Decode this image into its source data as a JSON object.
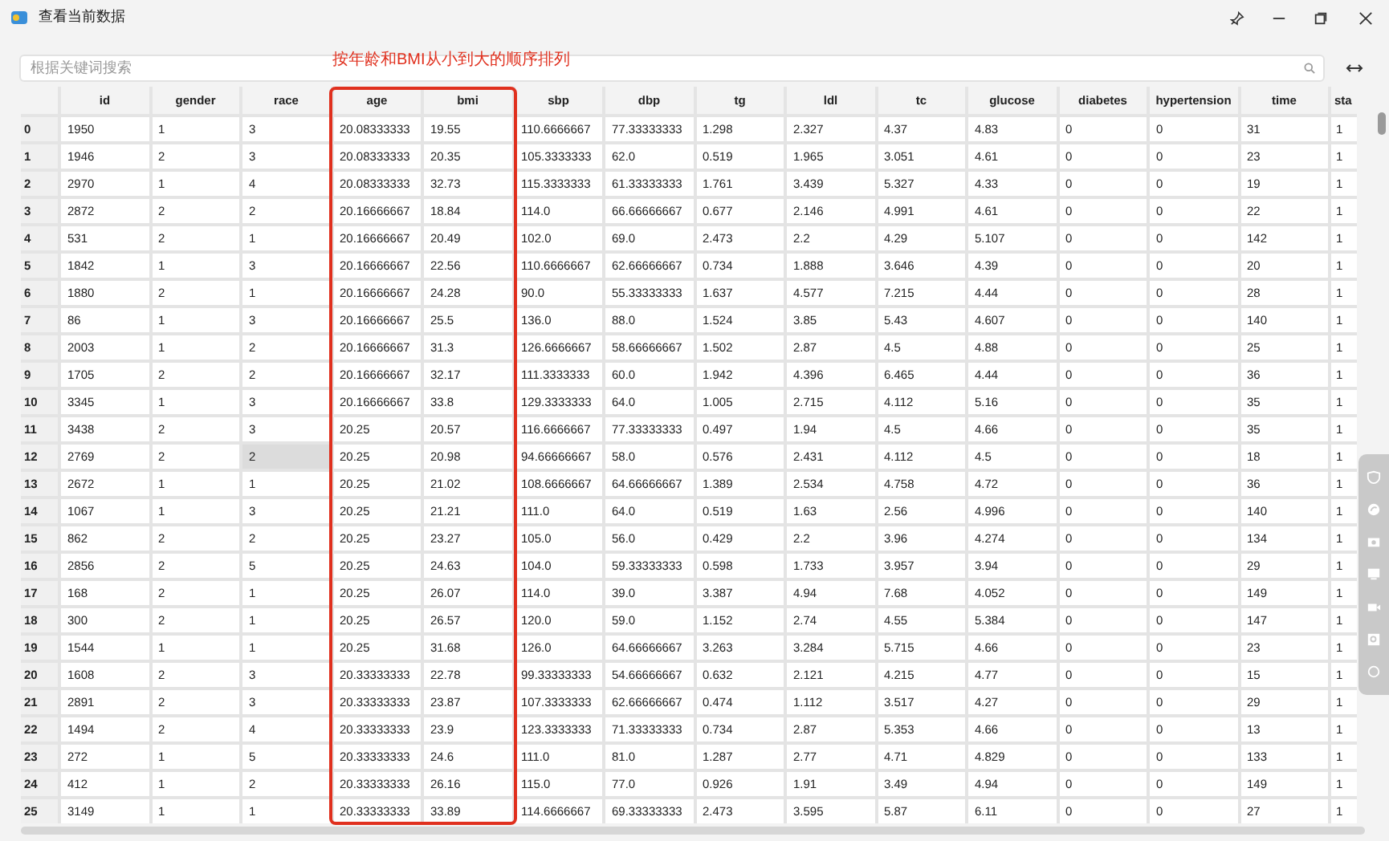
{
  "window": {
    "title": "查看当前数据"
  },
  "search": {
    "placeholder": "根据关键词搜索"
  },
  "annotation": {
    "text": "按年龄和BMI从小到大的顺序排列"
  },
  "table": {
    "columns": [
      "id",
      "gender",
      "race",
      "age",
      "bmi",
      "sbp",
      "dbp",
      "tg",
      "ldl",
      "tc",
      "glucose",
      "diabetes",
      "hypertension",
      "time",
      "sta"
    ],
    "rows": [
      {
        "label": "0",
        "cells": [
          "1950",
          "1",
          "3",
          "20.08333333",
          "19.55",
          "110.6666667",
          "77.33333333",
          "1.298",
          "2.327",
          "4.37",
          "4.83",
          "0",
          "0",
          "31",
          "1"
        ]
      },
      {
        "label": "1",
        "cells": [
          "1946",
          "2",
          "3",
          "20.08333333",
          "20.35",
          "105.3333333",
          "62.0",
          "0.519",
          "1.965",
          "3.051",
          "4.61",
          "0",
          "0",
          "23",
          "1"
        ]
      },
      {
        "label": "2",
        "cells": [
          "2970",
          "1",
          "4",
          "20.08333333",
          "32.73",
          "115.3333333",
          "61.33333333",
          "1.761",
          "3.439",
          "5.327",
          "4.33",
          "0",
          "0",
          "19",
          "1"
        ]
      },
      {
        "label": "3",
        "cells": [
          "2872",
          "2",
          "2",
          "20.16666667",
          "18.84",
          "114.0",
          "66.66666667",
          "0.677",
          "2.146",
          "4.991",
          "4.61",
          "0",
          "0",
          "22",
          "1"
        ]
      },
      {
        "label": "4",
        "cells": [
          "531",
          "2",
          "1",
          "20.16666667",
          "20.49",
          "102.0",
          "69.0",
          "2.473",
          "2.2",
          "4.29",
          "5.107",
          "0",
          "0",
          "142",
          "1"
        ]
      },
      {
        "label": "5",
        "cells": [
          "1842",
          "1",
          "3",
          "20.16666667",
          "22.56",
          "110.6666667",
          "62.66666667",
          "0.734",
          "1.888",
          "3.646",
          "4.39",
          "0",
          "0",
          "20",
          "1"
        ]
      },
      {
        "label": "6",
        "cells": [
          "1880",
          "2",
          "1",
          "20.16666667",
          "24.28",
          "90.0",
          "55.33333333",
          "1.637",
          "4.577",
          "7.215",
          "4.44",
          "0",
          "0",
          "28",
          "1"
        ]
      },
      {
        "label": "7",
        "cells": [
          "86",
          "1",
          "3",
          "20.16666667",
          "25.5",
          "136.0",
          "88.0",
          "1.524",
          "3.85",
          "5.43",
          "4.607",
          "0",
          "0",
          "140",
          "1"
        ]
      },
      {
        "label": "8",
        "cells": [
          "2003",
          "1",
          "2",
          "20.16666667",
          "31.3",
          "126.6666667",
          "58.66666667",
          "1.502",
          "2.87",
          "4.5",
          "4.88",
          "0",
          "0",
          "25",
          "1"
        ]
      },
      {
        "label": "9",
        "cells": [
          "1705",
          "2",
          "2",
          "20.16666667",
          "32.17",
          "111.3333333",
          "60.0",
          "1.942",
          "4.396",
          "6.465",
          "4.44",
          "0",
          "0",
          "36",
          "1"
        ]
      },
      {
        "label": "10",
        "cells": [
          "3345",
          "1",
          "3",
          "20.16666667",
          "33.8",
          "129.3333333",
          "64.0",
          "1.005",
          "2.715",
          "4.112",
          "5.16",
          "0",
          "0",
          "35",
          "1"
        ]
      },
      {
        "label": "11",
        "cells": [
          "3438",
          "2",
          "3",
          "20.25",
          "20.57",
          "116.6666667",
          "77.33333333",
          "0.497",
          "1.94",
          "4.5",
          "4.66",
          "0",
          "0",
          "35",
          "1"
        ]
      },
      {
        "label": "12",
        "cells": [
          "2769",
          "2",
          {
            "text": "2",
            "selected": true
          },
          "20.25",
          "20.98",
          "94.66666667",
          "58.0",
          "0.576",
          "2.431",
          "4.112",
          "4.5",
          "0",
          "0",
          "18",
          "1"
        ]
      },
      {
        "label": "13",
        "cells": [
          "2672",
          "1",
          "1",
          "20.25",
          "21.02",
          "108.6666667",
          "64.66666667",
          "1.389",
          "2.534",
          "4.758",
          "4.72",
          "0",
          "0",
          "36",
          "1"
        ]
      },
      {
        "label": "14",
        "cells": [
          "1067",
          "1",
          "3",
          "20.25",
          "21.21",
          "111.0",
          "64.0",
          "0.519",
          "1.63",
          "2.56",
          "4.996",
          "0",
          "0",
          "140",
          "1"
        ]
      },
      {
        "label": "15",
        "cells": [
          "862",
          "2",
          "2",
          "20.25",
          "23.27",
          "105.0",
          "56.0",
          "0.429",
          "2.2",
          "3.96",
          "4.274",
          "0",
          "0",
          "134",
          "1"
        ]
      },
      {
        "label": "16",
        "cells": [
          "2856",
          "2",
          "5",
          "20.25",
          "24.63",
          "104.0",
          "59.33333333",
          "0.598",
          "1.733",
          "3.957",
          "3.94",
          "0",
          "0",
          "29",
          "1"
        ]
      },
      {
        "label": "17",
        "cells": [
          "168",
          "2",
          "1",
          "20.25",
          "26.07",
          "114.0",
          "39.0",
          "3.387",
          "4.94",
          "7.68",
          "4.052",
          "0",
          "0",
          "149",
          "1"
        ]
      },
      {
        "label": "18",
        "cells": [
          "300",
          "2",
          "1",
          "20.25",
          "26.57",
          "120.0",
          "59.0",
          "1.152",
          "2.74",
          "4.55",
          "5.384",
          "0",
          "0",
          "147",
          "1"
        ]
      },
      {
        "label": "19",
        "cells": [
          "1544",
          "1",
          "1",
          "20.25",
          "31.68",
          "126.0",
          "64.66666667",
          "3.263",
          "3.284",
          "5.715",
          "4.66",
          "0",
          "0",
          "23",
          "1"
        ]
      },
      {
        "label": "20",
        "cells": [
          "1608",
          "2",
          "3",
          "20.33333333",
          "22.78",
          "99.33333333",
          "54.66666667",
          "0.632",
          "2.121",
          "4.215",
          "4.77",
          "0",
          "0",
          "15",
          "1"
        ]
      },
      {
        "label": "21",
        "cells": [
          "2891",
          "2",
          "3",
          "20.33333333",
          "23.87",
          "107.3333333",
          "62.66666667",
          "0.474",
          "1.112",
          "3.517",
          "4.27",
          "0",
          "0",
          "29",
          "1"
        ]
      },
      {
        "label": "22",
        "cells": [
          "1494",
          "2",
          "4",
          "20.33333333",
          "23.9",
          "123.3333333",
          "71.33333333",
          "0.734",
          "2.87",
          "5.353",
          "4.66",
          "0",
          "0",
          "13",
          "1"
        ]
      },
      {
        "label": "23",
        "cells": [
          "272",
          "1",
          "5",
          "20.33333333",
          "24.6",
          "111.0",
          "81.0",
          "1.287",
          "2.77",
          "4.71",
          "4.829",
          "0",
          "0",
          "133",
          "1"
        ]
      },
      {
        "label": "24",
        "cells": [
          "412",
          "1",
          "2",
          "20.33333333",
          "26.16",
          "115.0",
          "77.0",
          "0.926",
          "1.91",
          "3.49",
          "4.94",
          "0",
          "0",
          "149",
          "1"
        ]
      },
      {
        "label": "25",
        "cells": [
          "3149",
          "1",
          "1",
          "20.33333333",
          "33.89",
          "114.6666667",
          "69.33333333",
          "2.473",
          "3.595",
          "5.87",
          "6.11",
          "0",
          "0",
          "27",
          "1"
        ]
      }
    ]
  }
}
